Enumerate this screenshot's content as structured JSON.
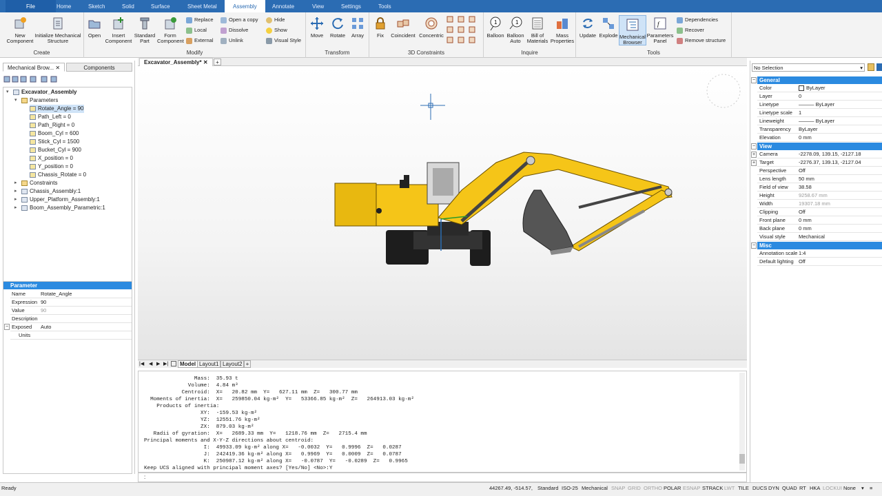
{
  "ribbon_tabs": [
    "File",
    "Home",
    "Sketch",
    "Solid",
    "Surface",
    "Sheet Metal",
    "Assembly",
    "Annotate",
    "View",
    "Settings",
    "Tools"
  ],
  "active_tab": "Assembly",
  "ribbon": {
    "create": {
      "label": "Create",
      "new_component": "New\nComponent",
      "init_mech": "Initialize Mechanical\nStructure"
    },
    "modify": {
      "label": "Modify",
      "open": "Open",
      "insert": "Insert\nComponent",
      "standard": "Standard\nPart",
      "form": "Form\nComponent",
      "replace": "Replace",
      "local": "Local",
      "external": "External",
      "open_copy": "Open a copy",
      "dissolve": "Dissolve",
      "unlink": "Unlink",
      "hide": "Hide",
      "show": "Show",
      "visual_style": "Visual Style"
    },
    "transform": {
      "label": "Transform",
      "move": "Move",
      "rotate": "Rotate",
      "array": "Array"
    },
    "constraints": {
      "label": "3D Constraints",
      "fix": "Fix",
      "coincident": "Coincident",
      "concentric": "Concentric"
    },
    "inquire": {
      "label": "Inquire",
      "balloon": "Balloon",
      "balloon_auto": "Balloon\nAuto",
      "bom": "Bill of\nMaterials",
      "mass": "Mass\nProperties"
    },
    "tools": {
      "label": "Tools",
      "update": "Update",
      "explode": "Explode",
      "mech_browser": "Mechanical\nBrowser",
      "param_panel": "Parameters\nPanel",
      "dependencies": "Dependencies",
      "recover": "Recover",
      "remove_structure": "Remove structure"
    }
  },
  "left_panel": {
    "tabs": [
      "Mechanical Brow...",
      "Components"
    ],
    "tree": {
      "root": "Excavator_Assembly",
      "parameters_label": "Parameters",
      "parameters": [
        "Rotate_Angle = 90",
        "Path_Left = 0",
        "Path_Right = 0",
        "Boom_Cyl = 600",
        "Stick_Cyl = 1500",
        "Bucket_Cyl = 900",
        "X_position = 0",
        "Y_position = 0",
        "Chassis_Rotate = 0"
      ],
      "others": [
        "Constraints",
        "Chassis_Assembly:1",
        "Upper_Platform_Assembly:1",
        "Boom_Assembly_Parametric:1"
      ]
    },
    "param_props": {
      "header": "Parameter",
      "rows": [
        [
          "Name",
          "Rotate_Angle"
        ],
        [
          "Expression",
          "90"
        ],
        [
          "Value",
          "90"
        ],
        [
          "Description",
          ""
        ]
      ],
      "exposed": [
        "Exposed",
        "Auto"
      ],
      "units": [
        "Units",
        ""
      ]
    }
  },
  "doc_tab": "Excavator_Assembly*",
  "layout_tabs": [
    "Model",
    "Layout1",
    "Layout2"
  ],
  "command_lines": [
    "                Mass:  35.93 t",
    "              Volume:  4.84 m³",
    "            Centroid:  X=   20.82 mm  Y=   627.11 mm  Z=   300.77 mm",
    "  Moments of inertia:  X=   259850.04 kg·m²  Y=   53366.85 kg·m²  Z=   264913.03 kg·m²",
    "    Products of inertia:",
    "                  XY:  -159.53 kg·m²",
    "                  YZ:  12551.76 kg·m²",
    "                  ZX:  879.03 kg·m²",
    "   Radii of gyration:  X=   2689.33 mm  Y=   1218.76 mm  Z=   2715.4 mm",
    "Principal moments and X-Y-Z directions about centroid:",
    "                   I:  49933.09 kg·m² along X=   -0.0032  Y=   0.9996  Z=   0.0287",
    "                   J:  242419.36 kg·m² along X=   0.9969  Y=   0.0009  Z=   0.0787",
    "                   K:  250987.12 kg·m² along X=   -0.0787  Y=   -0.0289  Z=   0.9965",
    "Keep UCS aligned with principal moment axes? [Yes/No] <No>:Y"
  ],
  "command_prompt": ":",
  "right_panel": {
    "selection": "No Selection",
    "general": {
      "header": "General",
      "rows": [
        [
          "Color",
          "ByLayer"
        ],
        [
          "Layer",
          "0"
        ],
        [
          "Linetype",
          "——— ByLayer"
        ],
        [
          "Linetype scale",
          "1"
        ],
        [
          "Lineweight",
          "——— ByLayer"
        ],
        [
          "Transparency",
          "ByLayer"
        ],
        [
          "Elevation",
          "0 mm"
        ]
      ]
    },
    "view": {
      "header": "View",
      "rows": [
        [
          "Camera",
          "-2278.09, 139.15, -2127.18"
        ],
        [
          "Target",
          "-2276.37, 139.13, -2127.04"
        ],
        [
          "Perspective",
          "Off"
        ],
        [
          "Lens length",
          "50 mm"
        ],
        [
          "Field of view",
          "38.58"
        ],
        [
          "Height",
          "9258.67 mm"
        ],
        [
          "Width",
          "19307.18 mm"
        ],
        [
          "Clipping",
          "Off"
        ],
        [
          "Front plane",
          "0 mm"
        ],
        [
          "Back plane",
          "0 mm"
        ],
        [
          "Visual style",
          "Mechanical"
        ]
      ]
    },
    "misc": {
      "header": "Misc",
      "rows": [
        [
          "Annotation scale",
          "1:4"
        ],
        [
          "Default lighting",
          "Off"
        ]
      ]
    }
  },
  "status": {
    "ready": "Ready",
    "coords": "44267.49, -514.57,",
    "items": [
      "Standard",
      "ISO-25",
      "Mechanical",
      "SNAP",
      "GRID",
      "ORTHO",
      "POLAR",
      "ESNAP",
      "STRACK",
      "LWT",
      "TILE",
      "DUCS",
      "DYN",
      "QUAD",
      "RT",
      "HKA",
      "LOCKUI",
      "None"
    ],
    "off": [
      "SNAP",
      "GRID",
      "ORTHO",
      "ESNAP",
      "LWT",
      "LOCKUI"
    ]
  },
  "colors": {
    "accent": "#2b6cb3",
    "excavator": "#f5c518",
    "header": "#2b8ae0"
  }
}
